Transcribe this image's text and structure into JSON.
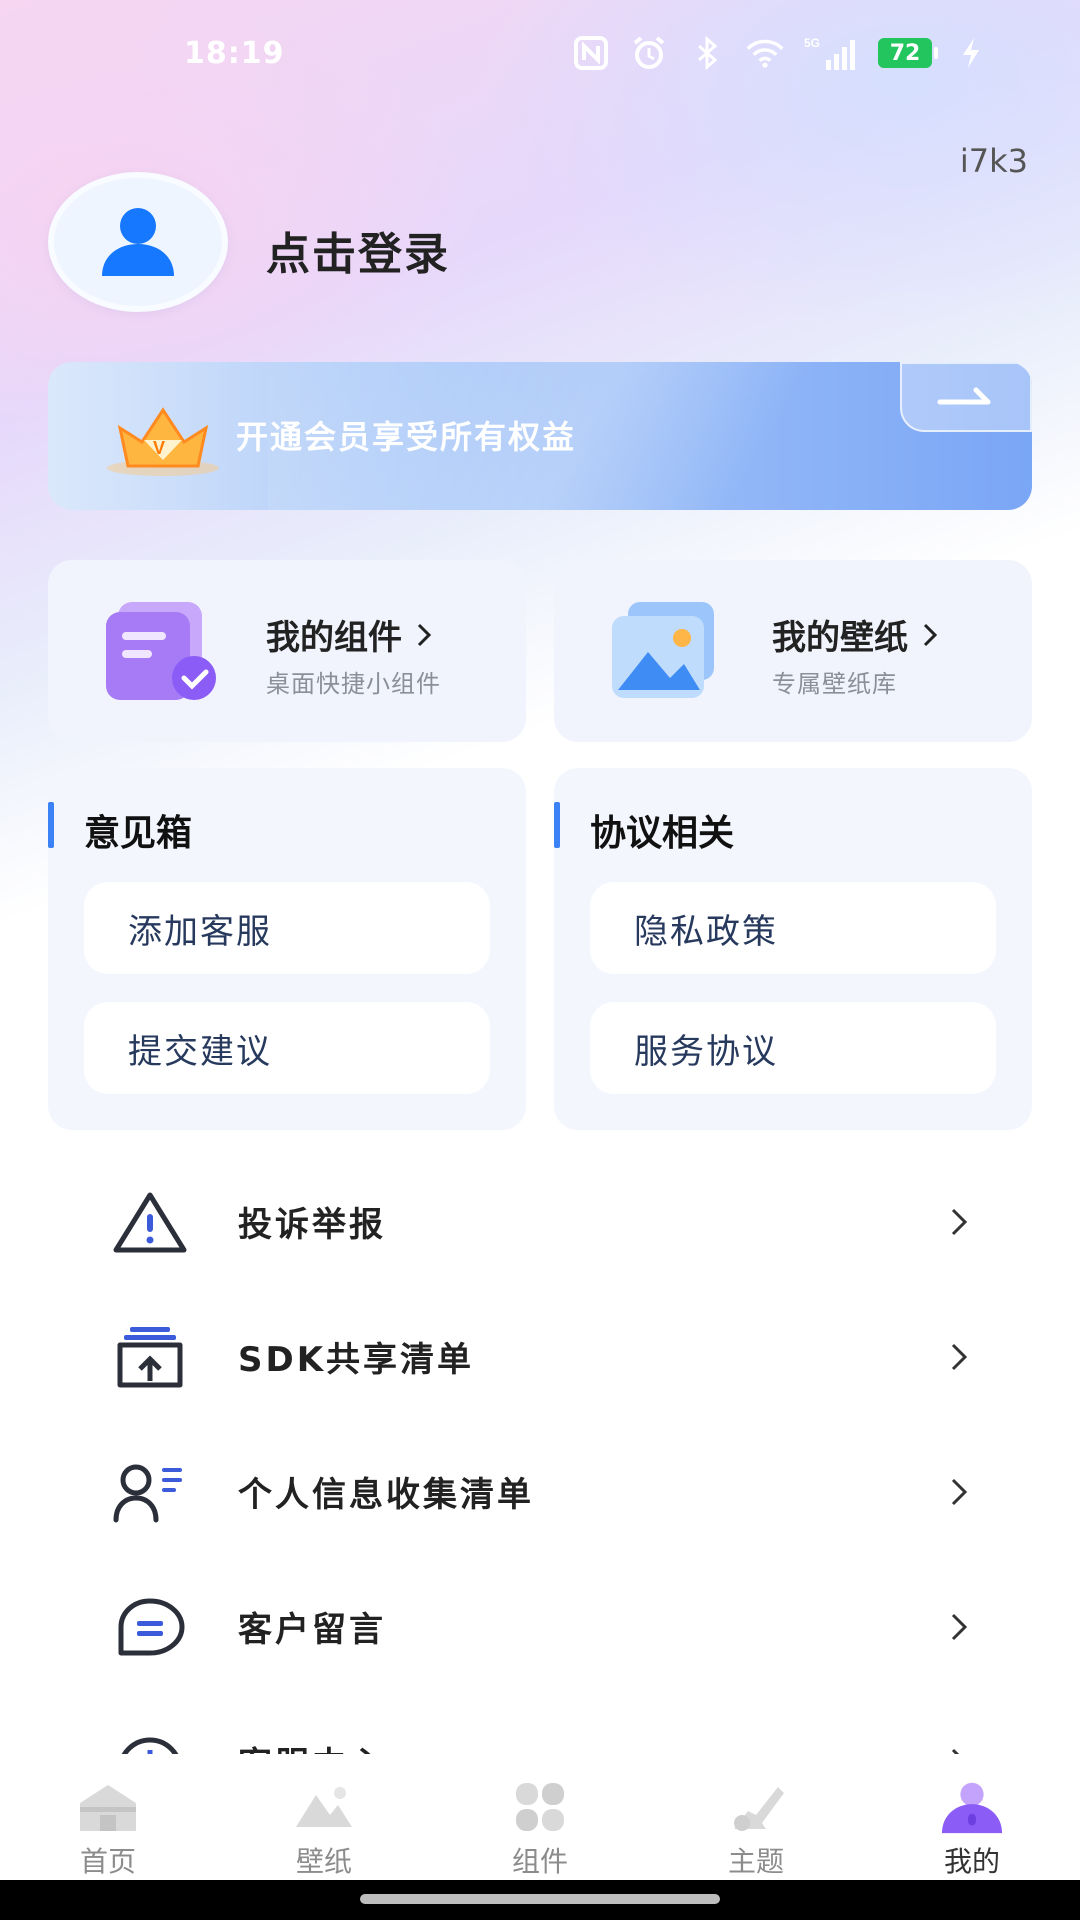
{
  "status_bar": {
    "time": "18:19",
    "battery": "72",
    "icons": [
      "nfc-icon",
      "alarm-icon",
      "bluetooth-icon",
      "wifi-icon",
      "signal-5g-icon",
      "charging-icon"
    ],
    "network_label": "5G"
  },
  "version": "i7k3",
  "profile": {
    "login_label": "点击登录"
  },
  "vip_banner": {
    "text": "开通会员享受所有权益"
  },
  "features": [
    {
      "title": "我的组件",
      "subtitle": "桌面快捷小组件"
    },
    {
      "title": "我的壁纸",
      "subtitle": "专属壁纸库"
    }
  ],
  "sections": {
    "feedback": {
      "title": "意见箱",
      "items": [
        "添加客服",
        "提交建议"
      ]
    },
    "agreements": {
      "title": "协议相关",
      "items": [
        "隐私政策",
        "服务协议"
      ]
    }
  },
  "list": [
    {
      "label": "投诉举报",
      "icon": "warning-icon"
    },
    {
      "label": "SDK共享清单",
      "icon": "share-list-icon"
    },
    {
      "label": "个人信息收集清单",
      "icon": "user-list-icon"
    },
    {
      "label": "客户留言",
      "icon": "message-icon"
    },
    {
      "label": "客服中心",
      "icon": "service-icon"
    }
  ],
  "bottom_nav": [
    {
      "label": "首页",
      "icon": "home-icon"
    },
    {
      "label": "壁纸",
      "icon": "wallpaper-icon"
    },
    {
      "label": "组件",
      "icon": "widget-icon"
    },
    {
      "label": "主题",
      "icon": "theme-icon"
    },
    {
      "label": "我的",
      "icon": "profile-icon",
      "active": true
    }
  ],
  "colors": {
    "accent": "#3b82f6",
    "active_nav": "#8b5cf6",
    "battery": "#22c55e"
  }
}
